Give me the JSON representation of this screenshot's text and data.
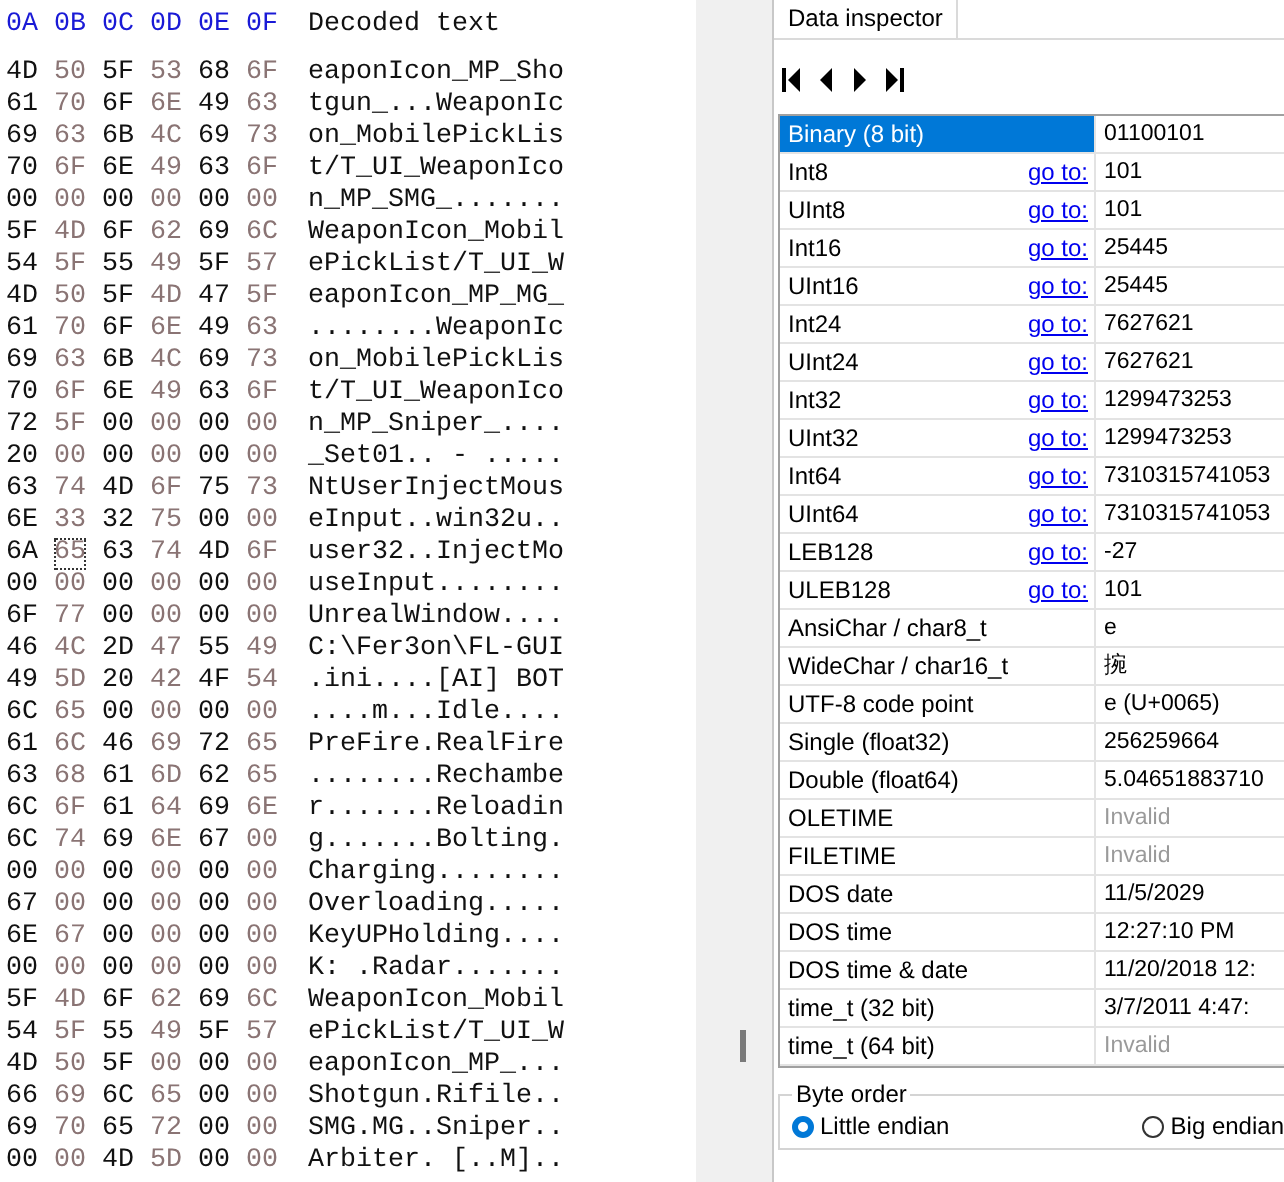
{
  "hex_view": {
    "columns": [
      "0A",
      "0B",
      "0C",
      "0D",
      "0E",
      "0F"
    ],
    "decoded_header": "Decoded text",
    "rows": [
      {
        "bytes": [
          {
            "v": "4D",
            "selected": false
          },
          {
            "v": "50",
            "selected": false
          },
          {
            "v": "5F",
            "selected": false
          },
          {
            "v": "53",
            "selected": false
          },
          {
            "v": "68",
            "selected": false
          },
          {
            "v": "6F",
            "selected": false
          }
        ],
        "text": "eaponIcon_MP_Sho"
      },
      {
        "bytes": [
          {
            "v": "61",
            "selected": false
          },
          {
            "v": "70",
            "selected": false
          },
          {
            "v": "6F",
            "selected": false
          },
          {
            "v": "6E",
            "selected": false
          },
          {
            "v": "49",
            "selected": false
          },
          {
            "v": "63",
            "selected": false
          }
        ],
        "text": "tgun_...WeaponIc"
      },
      {
        "bytes": [
          {
            "v": "69",
            "selected": false
          },
          {
            "v": "63",
            "selected": false
          },
          {
            "v": "6B",
            "selected": false
          },
          {
            "v": "4C",
            "selected": false
          },
          {
            "v": "69",
            "selected": false
          },
          {
            "v": "73",
            "selected": false
          }
        ],
        "text": "on_MobilePickLis"
      },
      {
        "bytes": [
          {
            "v": "70",
            "selected": false
          },
          {
            "v": "6F",
            "selected": false
          },
          {
            "v": "6E",
            "selected": false
          },
          {
            "v": "49",
            "selected": false
          },
          {
            "v": "63",
            "selected": false
          },
          {
            "v": "6F",
            "selected": false
          }
        ],
        "text": "t/T_UI_WeaponIco"
      },
      {
        "bytes": [
          {
            "v": "00",
            "selected": false
          },
          {
            "v": "00",
            "selected": false
          },
          {
            "v": "00",
            "selected": false
          },
          {
            "v": "00",
            "selected": false
          },
          {
            "v": "00",
            "selected": false
          },
          {
            "v": "00",
            "selected": false
          }
        ],
        "text": "n_MP_SMG_......."
      },
      {
        "bytes": [
          {
            "v": "5F",
            "selected": false
          },
          {
            "v": "4D",
            "selected": false
          },
          {
            "v": "6F",
            "selected": false
          },
          {
            "v": "62",
            "selected": false
          },
          {
            "v": "69",
            "selected": false
          },
          {
            "v": "6C",
            "selected": false
          }
        ],
        "text": "WeaponIcon_Mobil"
      },
      {
        "bytes": [
          {
            "v": "54",
            "selected": false
          },
          {
            "v": "5F",
            "selected": false
          },
          {
            "v": "55",
            "selected": false
          },
          {
            "v": "49",
            "selected": false
          },
          {
            "v": "5F",
            "selected": false
          },
          {
            "v": "57",
            "selected": false
          }
        ],
        "text": "ePickList/T_UI_W"
      },
      {
        "bytes": [
          {
            "v": "4D",
            "selected": false
          },
          {
            "v": "50",
            "selected": false
          },
          {
            "v": "5F",
            "selected": false
          },
          {
            "v": "4D",
            "selected": false
          },
          {
            "v": "47",
            "selected": false
          },
          {
            "v": "5F",
            "selected": false
          }
        ],
        "text": "eaponIcon_MP_MG_"
      },
      {
        "bytes": [
          {
            "v": "61",
            "selected": false
          },
          {
            "v": "70",
            "selected": false
          },
          {
            "v": "6F",
            "selected": false
          },
          {
            "v": "6E",
            "selected": false
          },
          {
            "v": "49",
            "selected": false
          },
          {
            "v": "63",
            "selected": false
          }
        ],
        "text": "........WeaponIc"
      },
      {
        "bytes": [
          {
            "v": "69",
            "selected": false
          },
          {
            "v": "63",
            "selected": false
          },
          {
            "v": "6B",
            "selected": false
          },
          {
            "v": "4C",
            "selected": false
          },
          {
            "v": "69",
            "selected": false
          },
          {
            "v": "73",
            "selected": false
          }
        ],
        "text": "on_MobilePickLis"
      },
      {
        "bytes": [
          {
            "v": "70",
            "selected": false
          },
          {
            "v": "6F",
            "selected": false
          },
          {
            "v": "6E",
            "selected": false
          },
          {
            "v": "49",
            "selected": false
          },
          {
            "v": "63",
            "selected": false
          },
          {
            "v": "6F",
            "selected": false
          }
        ],
        "text": "t/T_UI_WeaponIco"
      },
      {
        "bytes": [
          {
            "v": "72",
            "selected": false
          },
          {
            "v": "5F",
            "selected": false
          },
          {
            "v": "00",
            "selected": false
          },
          {
            "v": "00",
            "selected": false
          },
          {
            "v": "00",
            "selected": false
          },
          {
            "v": "00",
            "selected": false
          }
        ],
        "text": "n_MP_Sniper_...."
      },
      {
        "bytes": [
          {
            "v": "20",
            "selected": false
          },
          {
            "v": "00",
            "selected": false
          },
          {
            "v": "00",
            "selected": false
          },
          {
            "v": "00",
            "selected": false
          },
          {
            "v": "00",
            "selected": false
          },
          {
            "v": "00",
            "selected": false
          }
        ],
        "text": "_Set01.. - ....."
      },
      {
        "bytes": [
          {
            "v": "63",
            "selected": false
          },
          {
            "v": "74",
            "selected": false
          },
          {
            "v": "4D",
            "selected": false
          },
          {
            "v": "6F",
            "selected": false
          },
          {
            "v": "75",
            "selected": false
          },
          {
            "v": "73",
            "selected": false
          }
        ],
        "text": "NtUserInjectMous"
      },
      {
        "bytes": [
          {
            "v": "6E",
            "selected": false
          },
          {
            "v": "33",
            "selected": false
          },
          {
            "v": "32",
            "selected": false
          },
          {
            "v": "75",
            "selected": false
          },
          {
            "v": "00",
            "selected": false
          },
          {
            "v": "00",
            "selected": false
          }
        ],
        "text": "eInput..win32u.."
      },
      {
        "bytes": [
          {
            "v": "6A",
            "selected": false
          },
          {
            "v": "65",
            "selected": true
          },
          {
            "v": "63",
            "selected": false
          },
          {
            "v": "74",
            "selected": false
          },
          {
            "v": "4D",
            "selected": false
          },
          {
            "v": "6F",
            "selected": false
          }
        ],
        "text": "user32..InjectMo"
      },
      {
        "bytes": [
          {
            "v": "00",
            "selected": false
          },
          {
            "v": "00",
            "selected": false
          },
          {
            "v": "00",
            "selected": false
          },
          {
            "v": "00",
            "selected": false
          },
          {
            "v": "00",
            "selected": false
          },
          {
            "v": "00",
            "selected": false
          }
        ],
        "text": "useInput........"
      },
      {
        "bytes": [
          {
            "v": "6F",
            "selected": false
          },
          {
            "v": "77",
            "selected": false
          },
          {
            "v": "00",
            "selected": false
          },
          {
            "v": "00",
            "selected": false
          },
          {
            "v": "00",
            "selected": false
          },
          {
            "v": "00",
            "selected": false
          }
        ],
        "text": "UnrealWindow...."
      },
      {
        "bytes": [
          {
            "v": "46",
            "selected": false
          },
          {
            "v": "4C",
            "selected": false
          },
          {
            "v": "2D",
            "selected": false
          },
          {
            "v": "47",
            "selected": false
          },
          {
            "v": "55",
            "selected": false
          },
          {
            "v": "49",
            "selected": false
          }
        ],
        "text": "C:\\Fer3on\\FL-GUI"
      },
      {
        "bytes": [
          {
            "v": "49",
            "selected": false
          },
          {
            "v": "5D",
            "selected": false
          },
          {
            "v": "20",
            "selected": false
          },
          {
            "v": "42",
            "selected": false
          },
          {
            "v": "4F",
            "selected": false
          },
          {
            "v": "54",
            "selected": false
          }
        ],
        "text": ".ini....[AI] BOT"
      },
      {
        "bytes": [
          {
            "v": "6C",
            "selected": false
          },
          {
            "v": "65",
            "selected": false
          },
          {
            "v": "00",
            "selected": false
          },
          {
            "v": "00",
            "selected": false
          },
          {
            "v": "00",
            "selected": false
          },
          {
            "v": "00",
            "selected": false
          }
        ],
        "text": "....m...Idle...."
      },
      {
        "bytes": [
          {
            "v": "61",
            "selected": false
          },
          {
            "v": "6C",
            "selected": false
          },
          {
            "v": "46",
            "selected": false
          },
          {
            "v": "69",
            "selected": false
          },
          {
            "v": "72",
            "selected": false
          },
          {
            "v": "65",
            "selected": false
          }
        ],
        "text": "PreFire.RealFire"
      },
      {
        "bytes": [
          {
            "v": "63",
            "selected": false
          },
          {
            "v": "68",
            "selected": false
          },
          {
            "v": "61",
            "selected": false
          },
          {
            "v": "6D",
            "selected": false
          },
          {
            "v": "62",
            "selected": false
          },
          {
            "v": "65",
            "selected": false
          }
        ],
        "text": "........Rechambe"
      },
      {
        "bytes": [
          {
            "v": "6C",
            "selected": false
          },
          {
            "v": "6F",
            "selected": false
          },
          {
            "v": "61",
            "selected": false
          },
          {
            "v": "64",
            "selected": false
          },
          {
            "v": "69",
            "selected": false
          },
          {
            "v": "6E",
            "selected": false
          }
        ],
        "text": "r.......Reloadin"
      },
      {
        "bytes": [
          {
            "v": "6C",
            "selected": false
          },
          {
            "v": "74",
            "selected": false
          },
          {
            "v": "69",
            "selected": false
          },
          {
            "v": "6E",
            "selected": false
          },
          {
            "v": "67",
            "selected": false
          },
          {
            "v": "00",
            "selected": false
          }
        ],
        "text": "g.......Bolting."
      },
      {
        "bytes": [
          {
            "v": "00",
            "selected": false
          },
          {
            "v": "00",
            "selected": false
          },
          {
            "v": "00",
            "selected": false
          },
          {
            "v": "00",
            "selected": false
          },
          {
            "v": "00",
            "selected": false
          },
          {
            "v": "00",
            "selected": false
          }
        ],
        "text": "Charging........"
      },
      {
        "bytes": [
          {
            "v": "67",
            "selected": false
          },
          {
            "v": "00",
            "selected": false
          },
          {
            "v": "00",
            "selected": false
          },
          {
            "v": "00",
            "selected": false
          },
          {
            "v": "00",
            "selected": false
          },
          {
            "v": "00",
            "selected": false
          }
        ],
        "text": "Overloading....."
      },
      {
        "bytes": [
          {
            "v": "6E",
            "selected": false
          },
          {
            "v": "67",
            "selected": false
          },
          {
            "v": "00",
            "selected": false
          },
          {
            "v": "00",
            "selected": false
          },
          {
            "v": "00",
            "selected": false
          },
          {
            "v": "00",
            "selected": false
          }
        ],
        "text": "KeyUPHolding...."
      },
      {
        "bytes": [
          {
            "v": "00",
            "selected": false
          },
          {
            "v": "00",
            "selected": false
          },
          {
            "v": "00",
            "selected": false
          },
          {
            "v": "00",
            "selected": false
          },
          {
            "v": "00",
            "selected": false
          },
          {
            "v": "00",
            "selected": false
          }
        ],
        "text": "K: .Radar......."
      },
      {
        "bytes": [
          {
            "v": "5F",
            "selected": false
          },
          {
            "v": "4D",
            "selected": false
          },
          {
            "v": "6F",
            "selected": false
          },
          {
            "v": "62",
            "selected": false
          },
          {
            "v": "69",
            "selected": false
          },
          {
            "v": "6C",
            "selected": false
          }
        ],
        "text": "WeaponIcon_Mobil"
      },
      {
        "bytes": [
          {
            "v": "54",
            "selected": false
          },
          {
            "v": "5F",
            "selected": false
          },
          {
            "v": "55",
            "selected": false
          },
          {
            "v": "49",
            "selected": false
          },
          {
            "v": "5F",
            "selected": false
          },
          {
            "v": "57",
            "selected": false
          }
        ],
        "text": "ePickList/T_UI_W"
      },
      {
        "bytes": [
          {
            "v": "4D",
            "selected": false
          },
          {
            "v": "50",
            "selected": false
          },
          {
            "v": "5F",
            "selected": false
          },
          {
            "v": "00",
            "selected": false
          },
          {
            "v": "00",
            "selected": false
          },
          {
            "v": "00",
            "selected": false
          }
        ],
        "text": "eaponIcon_MP_..."
      },
      {
        "bytes": [
          {
            "v": "66",
            "selected": false
          },
          {
            "v": "69",
            "selected": false
          },
          {
            "v": "6C",
            "selected": false
          },
          {
            "v": "65",
            "selected": false
          },
          {
            "v": "00",
            "selected": false
          },
          {
            "v": "00",
            "selected": false
          }
        ],
        "text": "Shotgun.Rifile.."
      },
      {
        "bytes": [
          {
            "v": "69",
            "selected": false
          },
          {
            "v": "70",
            "selected": false
          },
          {
            "v": "65",
            "selected": false
          },
          {
            "v": "72",
            "selected": false
          },
          {
            "v": "00",
            "selected": false
          },
          {
            "v": "00",
            "selected": false
          }
        ],
        "text": "SMG.MG..Sniper.."
      },
      {
        "bytes": [
          {
            "v": "00",
            "selected": false
          },
          {
            "v": "00",
            "selected": false
          },
          {
            "v": "4D",
            "selected": false
          },
          {
            "v": "5D",
            "selected": false
          },
          {
            "v": "00",
            "selected": false
          },
          {
            "v": "00",
            "selected": false
          }
        ],
        "text": "Arbiter. [..M].."
      }
    ]
  },
  "data_inspector": {
    "tab": "Data inspector",
    "rows": [
      {
        "label": "Binary (8 bit)",
        "value": "01100101",
        "selected": true,
        "dimmed": false
      },
      {
        "label": "Int8",
        "link": "go to:",
        "value": "101",
        "selected": false,
        "dimmed": false
      },
      {
        "label": "UInt8",
        "link": "go to:",
        "value": "101",
        "selected": false,
        "dimmed": false
      },
      {
        "label": "Int16",
        "link": "go to:",
        "value": "25445",
        "selected": false,
        "dimmed": false
      },
      {
        "label": "UInt16",
        "link": "go to:",
        "value": "25445",
        "selected": false,
        "dimmed": false
      },
      {
        "label": "Int24",
        "link": "go to:",
        "value": "7627621",
        "selected": false,
        "dimmed": false
      },
      {
        "label": "UInt24",
        "link": "go to:",
        "value": "7627621",
        "selected": false,
        "dimmed": false
      },
      {
        "label": "Int32",
        "link": "go to:",
        "value": "1299473253",
        "selected": false,
        "dimmed": false
      },
      {
        "label": "UInt32",
        "link": "go to:",
        "value": "1299473253",
        "selected": false,
        "dimmed": false
      },
      {
        "label": "Int64",
        "link": "go to:",
        "value": "7310315741053",
        "selected": false,
        "dimmed": false
      },
      {
        "label": "UInt64",
        "link": "go to:",
        "value": "7310315741053",
        "selected": false,
        "dimmed": false
      },
      {
        "label": "LEB128",
        "link": "go to:",
        "value": "-27",
        "selected": false,
        "dimmed": false
      },
      {
        "label": "ULEB128",
        "link": "go to:",
        "value": "101",
        "selected": false,
        "dimmed": false
      },
      {
        "label": "AnsiChar / char8_t",
        "value": "e",
        "selected": false,
        "dimmed": false
      },
      {
        "label": "WideChar / char16_t",
        "value": "捥",
        "selected": false,
        "dimmed": false
      },
      {
        "label": "UTF-8 code point",
        "value": "e (U+0065)",
        "selected": false,
        "dimmed": false
      },
      {
        "label": "Single (float32)",
        "value": "256259664",
        "selected": false,
        "dimmed": false
      },
      {
        "label": "Double (float64)",
        "value": "5.04651883710",
        "selected": false,
        "dimmed": false
      },
      {
        "label": "OLETIME",
        "value": "Invalid",
        "selected": false,
        "dimmed": true
      },
      {
        "label": "FILETIME",
        "value": "Invalid",
        "selected": false,
        "dimmed": true
      },
      {
        "label": "DOS date",
        "value": "11/5/2029",
        "selected": false,
        "dimmed": false
      },
      {
        "label": "DOS time",
        "value": "12:27:10 PM",
        "selected": false,
        "dimmed": false
      },
      {
        "label": "DOS time & date",
        "value": "11/20/2018 12:",
        "selected": false,
        "dimmed": false
      },
      {
        "label": "time_t (32 bit)",
        "value": "3/7/2011 4:47:",
        "selected": false,
        "dimmed": false
      },
      {
        "label": "time_t (64 bit)",
        "value": "Invalid",
        "selected": false,
        "dimmed": true
      }
    ],
    "byte_order": {
      "title": "Byte order",
      "options": [
        {
          "label": "Little endian",
          "selected": true
        },
        {
          "label": "Big endian",
          "selected": false
        }
      ]
    }
  }
}
